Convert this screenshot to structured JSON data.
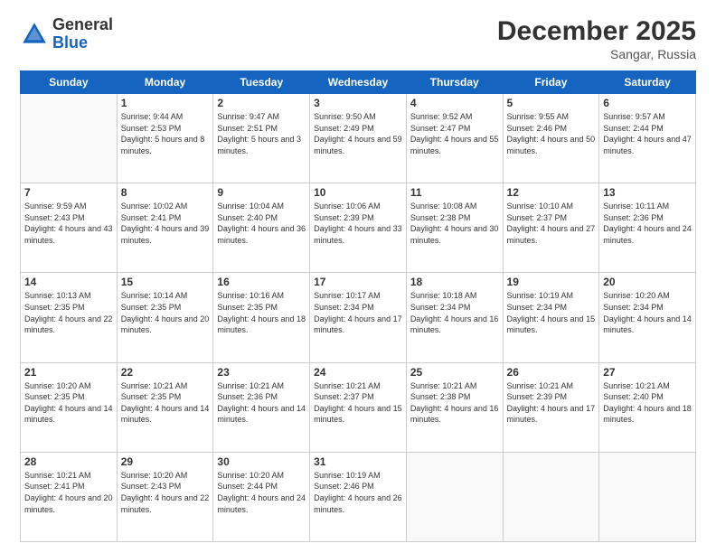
{
  "header": {
    "logo_general": "General",
    "logo_blue": "Blue",
    "month_title": "December 2025",
    "location": "Sangar, Russia"
  },
  "weekdays": [
    "Sunday",
    "Monday",
    "Tuesday",
    "Wednesday",
    "Thursday",
    "Friday",
    "Saturday"
  ],
  "weeks": [
    [
      {
        "day": "",
        "sunrise": "",
        "sunset": "",
        "daylight": ""
      },
      {
        "day": "1",
        "sunrise": "Sunrise: 9:44 AM",
        "sunset": "Sunset: 2:53 PM",
        "daylight": "Daylight: 5 hours and 8 minutes."
      },
      {
        "day": "2",
        "sunrise": "Sunrise: 9:47 AM",
        "sunset": "Sunset: 2:51 PM",
        "daylight": "Daylight: 5 hours and 3 minutes."
      },
      {
        "day": "3",
        "sunrise": "Sunrise: 9:50 AM",
        "sunset": "Sunset: 2:49 PM",
        "daylight": "Daylight: 4 hours and 59 minutes."
      },
      {
        "day": "4",
        "sunrise": "Sunrise: 9:52 AM",
        "sunset": "Sunset: 2:47 PM",
        "daylight": "Daylight: 4 hours and 55 minutes."
      },
      {
        "day": "5",
        "sunrise": "Sunrise: 9:55 AM",
        "sunset": "Sunset: 2:46 PM",
        "daylight": "Daylight: 4 hours and 50 minutes."
      },
      {
        "day": "6",
        "sunrise": "Sunrise: 9:57 AM",
        "sunset": "Sunset: 2:44 PM",
        "daylight": "Daylight: 4 hours and 47 minutes."
      }
    ],
    [
      {
        "day": "7",
        "sunrise": "Sunrise: 9:59 AM",
        "sunset": "Sunset: 2:43 PM",
        "daylight": "Daylight: 4 hours and 43 minutes."
      },
      {
        "day": "8",
        "sunrise": "Sunrise: 10:02 AM",
        "sunset": "Sunset: 2:41 PM",
        "daylight": "Daylight: 4 hours and 39 minutes."
      },
      {
        "day": "9",
        "sunrise": "Sunrise: 10:04 AM",
        "sunset": "Sunset: 2:40 PM",
        "daylight": "Daylight: 4 hours and 36 minutes."
      },
      {
        "day": "10",
        "sunrise": "Sunrise: 10:06 AM",
        "sunset": "Sunset: 2:39 PM",
        "daylight": "Daylight: 4 hours and 33 minutes."
      },
      {
        "day": "11",
        "sunrise": "Sunrise: 10:08 AM",
        "sunset": "Sunset: 2:38 PM",
        "daylight": "Daylight: 4 hours and 30 minutes."
      },
      {
        "day": "12",
        "sunrise": "Sunrise: 10:10 AM",
        "sunset": "Sunset: 2:37 PM",
        "daylight": "Daylight: 4 hours and 27 minutes."
      },
      {
        "day": "13",
        "sunrise": "Sunrise: 10:11 AM",
        "sunset": "Sunset: 2:36 PM",
        "daylight": "Daylight: 4 hours and 24 minutes."
      }
    ],
    [
      {
        "day": "14",
        "sunrise": "Sunrise: 10:13 AM",
        "sunset": "Sunset: 2:35 PM",
        "daylight": "Daylight: 4 hours and 22 minutes."
      },
      {
        "day": "15",
        "sunrise": "Sunrise: 10:14 AM",
        "sunset": "Sunset: 2:35 PM",
        "daylight": "Daylight: 4 hours and 20 minutes."
      },
      {
        "day": "16",
        "sunrise": "Sunrise: 10:16 AM",
        "sunset": "Sunset: 2:35 PM",
        "daylight": "Daylight: 4 hours and 18 minutes."
      },
      {
        "day": "17",
        "sunrise": "Sunrise: 10:17 AM",
        "sunset": "Sunset: 2:34 PM",
        "daylight": "Daylight: 4 hours and 17 minutes."
      },
      {
        "day": "18",
        "sunrise": "Sunrise: 10:18 AM",
        "sunset": "Sunset: 2:34 PM",
        "daylight": "Daylight: 4 hours and 16 minutes."
      },
      {
        "day": "19",
        "sunrise": "Sunrise: 10:19 AM",
        "sunset": "Sunset: 2:34 PM",
        "daylight": "Daylight: 4 hours and 15 minutes."
      },
      {
        "day": "20",
        "sunrise": "Sunrise: 10:20 AM",
        "sunset": "Sunset: 2:34 PM",
        "daylight": "Daylight: 4 hours and 14 minutes."
      }
    ],
    [
      {
        "day": "21",
        "sunrise": "Sunrise: 10:20 AM",
        "sunset": "Sunset: 2:35 PM",
        "daylight": "Daylight: 4 hours and 14 minutes."
      },
      {
        "day": "22",
        "sunrise": "Sunrise: 10:21 AM",
        "sunset": "Sunset: 2:35 PM",
        "daylight": "Daylight: 4 hours and 14 minutes."
      },
      {
        "day": "23",
        "sunrise": "Sunrise: 10:21 AM",
        "sunset": "Sunset: 2:36 PM",
        "daylight": "Daylight: 4 hours and 14 minutes."
      },
      {
        "day": "24",
        "sunrise": "Sunrise: 10:21 AM",
        "sunset": "Sunset: 2:37 PM",
        "daylight": "Daylight: 4 hours and 15 minutes."
      },
      {
        "day": "25",
        "sunrise": "Sunrise: 10:21 AM",
        "sunset": "Sunset: 2:38 PM",
        "daylight": "Daylight: 4 hours and 16 minutes."
      },
      {
        "day": "26",
        "sunrise": "Sunrise: 10:21 AM",
        "sunset": "Sunset: 2:39 PM",
        "daylight": "Daylight: 4 hours and 17 minutes."
      },
      {
        "day": "27",
        "sunrise": "Sunrise: 10:21 AM",
        "sunset": "Sunset: 2:40 PM",
        "daylight": "Daylight: 4 hours and 18 minutes."
      }
    ],
    [
      {
        "day": "28",
        "sunrise": "Sunrise: 10:21 AM",
        "sunset": "Sunset: 2:41 PM",
        "daylight": "Daylight: 4 hours and 20 minutes."
      },
      {
        "day": "29",
        "sunrise": "Sunrise: 10:20 AM",
        "sunset": "Sunset: 2:43 PM",
        "daylight": "Daylight: 4 hours and 22 minutes."
      },
      {
        "day": "30",
        "sunrise": "Sunrise: 10:20 AM",
        "sunset": "Sunset: 2:44 PM",
        "daylight": "Daylight: 4 hours and 24 minutes."
      },
      {
        "day": "31",
        "sunrise": "Sunrise: 10:19 AM",
        "sunset": "Sunset: 2:46 PM",
        "daylight": "Daylight: 4 hours and 26 minutes."
      },
      {
        "day": "",
        "sunrise": "",
        "sunset": "",
        "daylight": ""
      },
      {
        "day": "",
        "sunrise": "",
        "sunset": "",
        "daylight": ""
      },
      {
        "day": "",
        "sunrise": "",
        "sunset": "",
        "daylight": ""
      }
    ]
  ]
}
